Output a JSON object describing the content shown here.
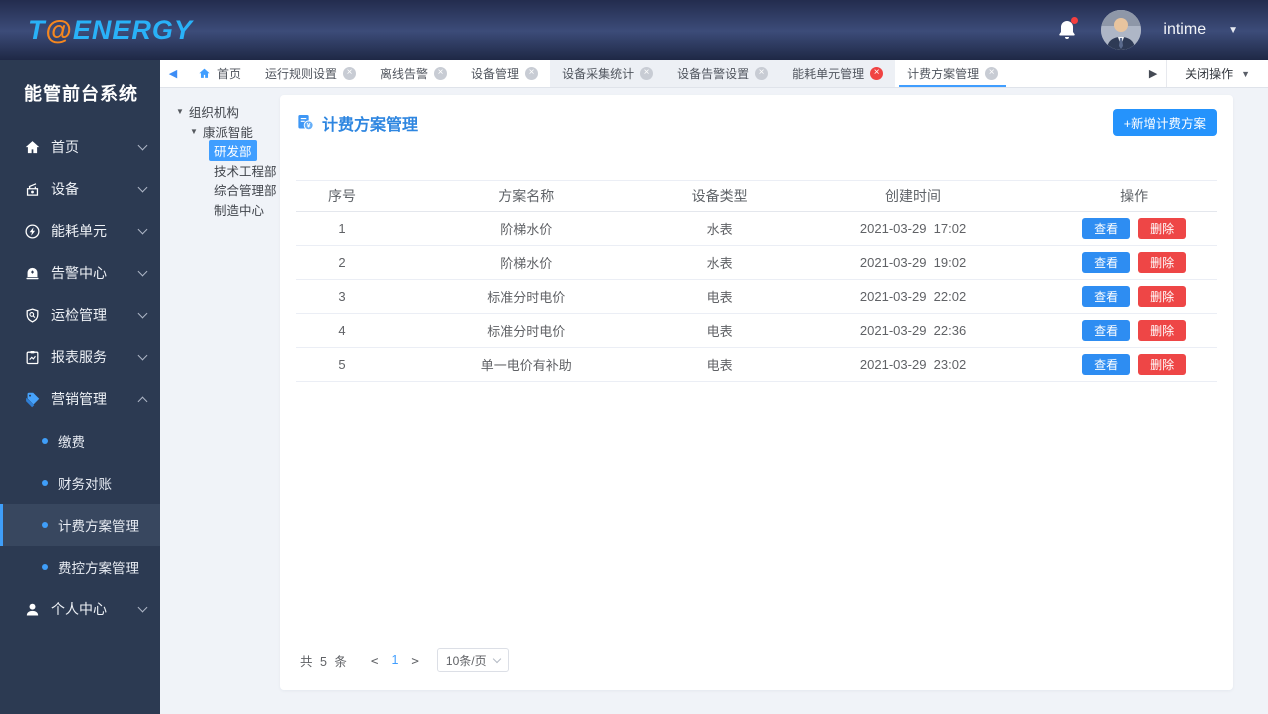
{
  "header": {
    "logo_t": "T",
    "logo_at": "@",
    "logo_rest": "ENERGY",
    "username": "intime"
  },
  "sidebar": {
    "title": "能管前台系统",
    "items": [
      {
        "label": "首页",
        "icon": "home-icon"
      },
      {
        "label": "设备",
        "icon": "device-icon"
      },
      {
        "label": "能耗单元",
        "icon": "energy-icon"
      },
      {
        "label": "告警中心",
        "icon": "alarm-icon"
      },
      {
        "label": "运检管理",
        "icon": "inspection-icon"
      },
      {
        "label": "报表服务",
        "icon": "report-icon"
      },
      {
        "label": "营销管理",
        "icon": "marketing-icon"
      },
      {
        "label": "个人中心",
        "icon": "person-icon"
      }
    ],
    "sub_items": [
      {
        "label": "缴费"
      },
      {
        "label": "财务对账"
      },
      {
        "label": "计费方案管理",
        "selected": true
      },
      {
        "label": "费控方案管理"
      }
    ]
  },
  "tabbar": {
    "tabs": [
      {
        "label": "首页"
      },
      {
        "label": "运行规则设置"
      },
      {
        "label": "离线告警"
      },
      {
        "label": "设备管理"
      },
      {
        "label": "设备采集统计"
      },
      {
        "label": "设备告警设置"
      },
      {
        "label": "能耗单元管理"
      },
      {
        "label": "计费方案管理"
      }
    ],
    "close_ops": "关闭操作"
  },
  "tree": {
    "root": "组织机构",
    "company": "康派智能",
    "departments": [
      "研发部",
      "技术工程部",
      "综合管理部",
      "制造中心"
    ],
    "selected": "研发部"
  },
  "main": {
    "title": "计费方案管理",
    "add_button": "+新增计费方案",
    "table": {
      "headers": [
        "序号",
        "方案名称",
        "设备类型",
        "创建时间",
        "操作"
      ],
      "rows": [
        {
          "no": "1",
          "name": "阶梯水价",
          "type": "水表",
          "time": "2021-03-29  17:02"
        },
        {
          "no": "2",
          "name": "阶梯水价",
          "type": "水表",
          "time": "2021-03-29  19:02"
        },
        {
          "no": "3",
          "name": "标准分时电价",
          "type": "电表",
          "time": "2021-03-29  22:02"
        },
        {
          "no": "4",
          "name": "标准分时电价",
          "type": "电表",
          "time": "2021-03-29  22:36"
        },
        {
          "no": "5",
          "name": "单一电价有补助",
          "type": "电表",
          "time": "2021-03-29  23:02"
        }
      ],
      "view_label": "查看",
      "delete_label": "删除"
    },
    "pagination": {
      "total_text": "共 5 条",
      "prev": "<",
      "page": "1",
      "next": ">",
      "page_size": "10条/页"
    }
  },
  "icons": {
    "close_glyph": "×",
    "caret_down_glyph": "▼",
    "arrow_left_glyph": "◀",
    "arrow_right_glyph": "▶"
  },
  "colors": {
    "accent_blue": "#409eff",
    "button_blue": "#2593fc",
    "danger_red": "#ee4646",
    "sidebar_bg": "#2c3a52",
    "page_bg": "#f0f3f8",
    "title_blue": "#2e86e0"
  }
}
